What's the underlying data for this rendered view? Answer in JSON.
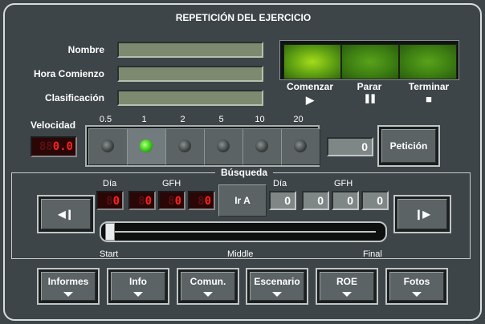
{
  "title": "REPETICIÓN DEL EJERCICIO",
  "fields": [
    {
      "label": "Nombre",
      "value": ""
    },
    {
      "label": "Hora Comienzo",
      "value": ""
    },
    {
      "label": "Clasificación",
      "value": ""
    }
  ],
  "playback": {
    "start_label": "Comenzar",
    "stop_label": "Parar",
    "end_label": "Terminar",
    "start_icon": "▶",
    "stop_icon": "❚❚",
    "end_icon": "■"
  },
  "speed": {
    "label": "Velocidad",
    "display": "0.0",
    "display_ghost": "88",
    "options": [
      "0.5",
      "1",
      "2",
      "5",
      "10",
      "20"
    ],
    "selected": "1"
  },
  "request": {
    "count": "0",
    "button_label": "Petición"
  },
  "search": {
    "title": "Búsqueda",
    "day_label": "Día",
    "gfh_label": "GFH",
    "led_day": "0",
    "led_gfh": [
      "0",
      "0",
      "0"
    ],
    "led_ghost": "8",
    "goto_label": "Ir A",
    "day_value": "0",
    "gfh_values": [
      "0",
      "0",
      "0"
    ],
    "prev_icon": "◀❙",
    "next_icon": "❙▶",
    "slider_start": "Start",
    "slider_middle": "Middle",
    "slider_end": "Final",
    "slider_position": 0
  },
  "menu": [
    "Informes",
    "Info",
    "Comun.",
    "Escenario",
    "ROE",
    "Fotos"
  ]
}
